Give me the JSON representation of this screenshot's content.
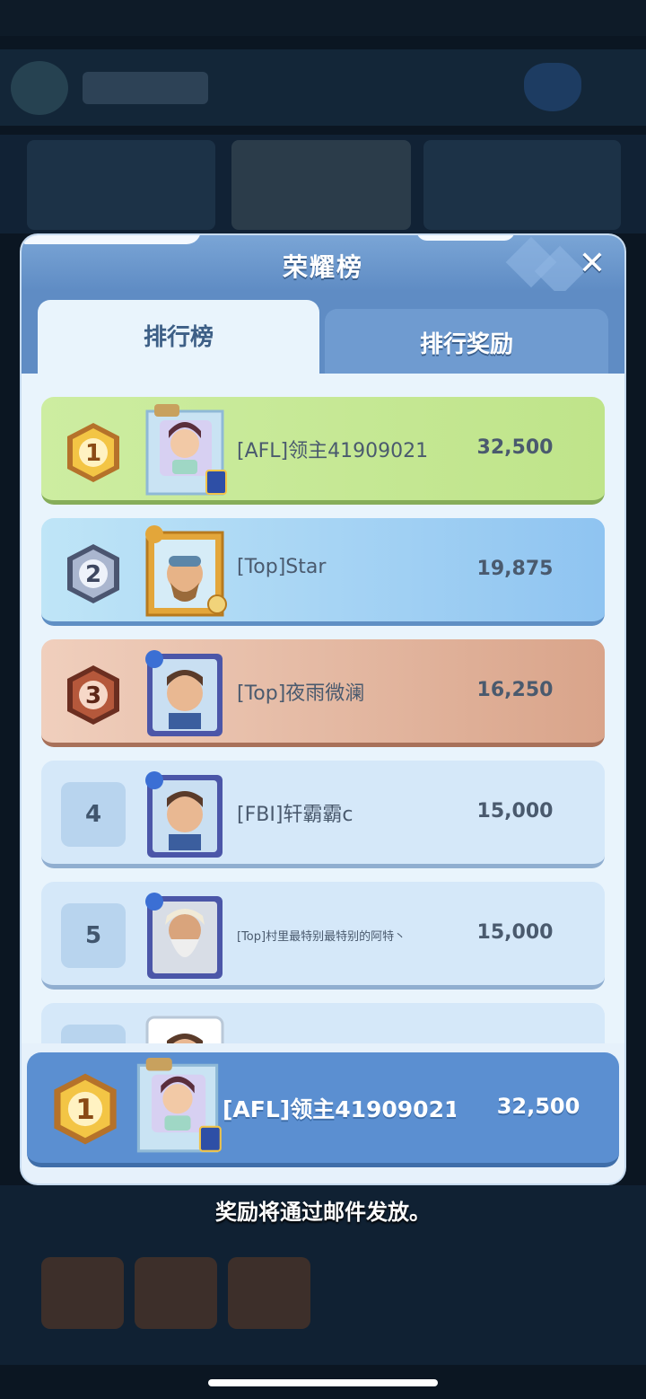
{
  "modal": {
    "title": "荣耀榜",
    "close_icon": "close-icon",
    "tabs": [
      {
        "label": "排行榜",
        "active": true
      },
      {
        "label": "排行奖励",
        "active": false
      }
    ]
  },
  "leaderboard": {
    "rows": [
      {
        "rank": "1",
        "name": "[AFL]领主41909021",
        "score": "32,500"
      },
      {
        "rank": "2",
        "name": "[Top]Star",
        "score": "19,875"
      },
      {
        "rank": "3",
        "name": "[Top]夜雨微澜",
        "score": "16,250"
      },
      {
        "rank": "4",
        "name": "[FBI]轩霸霸c",
        "score": "15,000"
      },
      {
        "rank": "5",
        "name": "[Top]村里最特别最特别的阿特丶",
        "score": "15,000"
      }
    ]
  },
  "self_entry": {
    "rank": "1",
    "name": "[AFL]领主41909021",
    "score": "32,500"
  },
  "footer": {
    "note": "奖励将通过邮件发放。"
  },
  "colors": {
    "gold_row": "#c6e994",
    "silver_row": "#a6d4f4",
    "bronze_row": "#e4b8a2",
    "plain_row": "#d5e8f9",
    "self_row": "#5b8fd1",
    "header": "#6f9bd0"
  }
}
